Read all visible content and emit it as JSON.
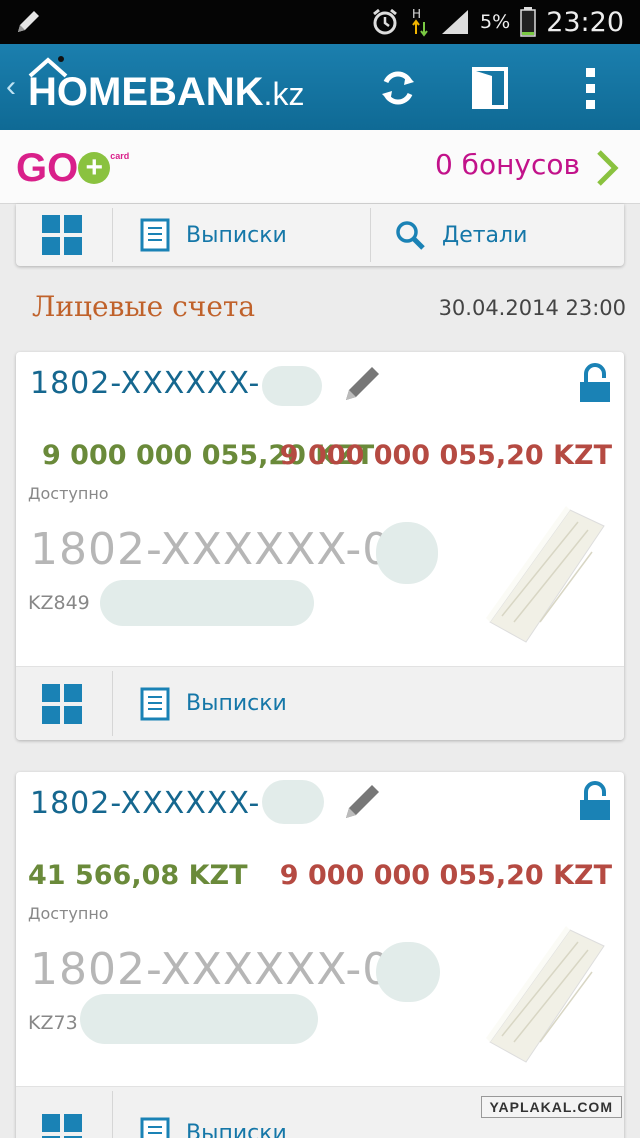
{
  "status_bar": {
    "battery_percent": "5%",
    "time": "23:20",
    "icons": [
      "pencil-icon",
      "alarm-icon",
      "data-arrows-icon",
      "signal-icon",
      "battery-icon"
    ]
  },
  "app_bar": {
    "logo_text": "HOMEBANK",
    "logo_suffix": ".kz",
    "actions": [
      "refresh-icon",
      "logout-door-icon",
      "overflow-menu-icon"
    ]
  },
  "bonus_bar": {
    "logo": "GO",
    "logo_small": "card",
    "bonus_text": "0 бонусов"
  },
  "toolbar": {
    "statements_label": "Выписки",
    "details_label": "Детали"
  },
  "section": {
    "title": "Лицевые счета",
    "date": "30.04.2014 23:00"
  },
  "accounts": [
    {
      "number_prefix": "1802-XXXXXX-",
      "amount_available": "9 000 000 055,20 KZT",
      "amount_right": "9 000 000 055,20 KZT",
      "available_label": "Доступно",
      "account_big": "1802-XXXXXX-0",
      "iban_prefix": "KZ849",
      "statements_label": "Выписки"
    },
    {
      "number_prefix": "1802-XXXXXX-",
      "amount_available": "41 566,08 KZT",
      "amount_right": "9 000 000 055,20 KZT",
      "available_label": "Доступно",
      "account_big": "1802-XXXXXX-0",
      "iban_prefix": "KZ73",
      "statements_label": "Выписки"
    }
  ],
  "watermark": "YAPLAKAL.COM",
  "colors": {
    "app_bar": "#1478a8",
    "accent_blue": "#1577a8",
    "bonus_magenta": "#c2128a",
    "amount_green": "#6a8a3a",
    "amount_red": "#b54a42",
    "section_orange": "#c0622b"
  }
}
